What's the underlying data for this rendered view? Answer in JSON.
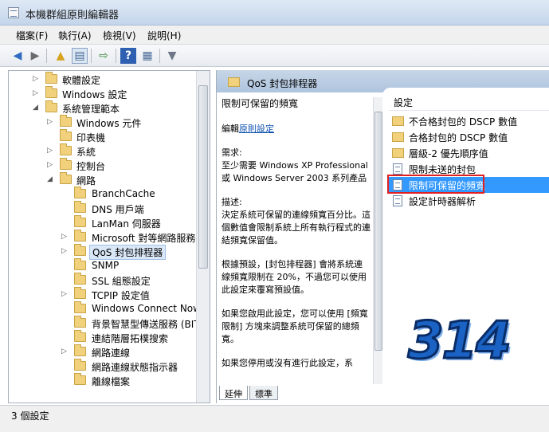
{
  "window": {
    "title": "本機群組原則編輯器"
  },
  "menubar": {
    "items": [
      "檔案(F)",
      "執行(A)",
      "檢視(V)",
      "說明(H)"
    ]
  },
  "toolbar": {
    "buttons": [
      "back-arrow",
      "forward-arrow",
      "up-folder",
      "show-hide-console-tree",
      "export-list",
      "help",
      "properties",
      "filter"
    ]
  },
  "tree": {
    "items": [
      {
        "label": "軟體設定",
        "expanded": false
      },
      {
        "label": "Windows 設定",
        "expanded": false
      },
      {
        "label": "系統管理範本",
        "expanded": true
      },
      {
        "label": "Windows 元件",
        "expanded": false
      },
      {
        "label": "印表機",
        "expanded": null
      },
      {
        "label": "系統",
        "expanded": false
      },
      {
        "label": "控制台",
        "expanded": false
      },
      {
        "label": "網路",
        "expanded": true
      },
      {
        "label": "BranchCache",
        "expanded": null
      },
      {
        "label": "DNS 用戶端",
        "expanded": null
      },
      {
        "label": "LanMan 伺服器",
        "expanded": null
      },
      {
        "label": "Microsoft 對等網路服務",
        "expanded": false
      },
      {
        "label": "QoS 封包排程器",
        "expanded": false,
        "selected": true
      },
      {
        "label": "SNMP",
        "expanded": null
      },
      {
        "label": "SSL 組態設定",
        "expanded": null
      },
      {
        "label": "TCPIP 設定值",
        "expanded": false
      },
      {
        "label": "Windows Connect Now",
        "expanded": null
      },
      {
        "label": "背景智慧型傳送服務 (BITS)",
        "expanded": null
      },
      {
        "label": "連結階層拓樸搜索",
        "expanded": null
      },
      {
        "label": "網路連線",
        "expanded": false
      },
      {
        "label": "網路連線狀態指示器",
        "expanded": null
      },
      {
        "label": "離線檔案",
        "expanded": null
      }
    ]
  },
  "details": {
    "header": "QoS 封包排程器",
    "setting_title": "限制可保留的頻寬",
    "edit_prefix": "編輯",
    "edit_link": "原則設定",
    "requirement_label": "需求:",
    "requirement_text": "至少需要 Windows XP Professional 或 Windows Server 2003 系列產品",
    "description_label": "描述:",
    "description_text": "決定系統可保留的連線頻寬百分比。這個數值會限制系統上所有執行程式的連結頻寬保留值。",
    "default_text": "根據預設，[封包排程器] 會將系統連線頻寬限制在 20%，不過您可以使用此設定來覆寫預設值。",
    "enable_text": "如果您啟用此設定，您可以使用 [頻寬限制] 方塊來調整系統可保留的總頻寬。",
    "cut_text": "如果您停用或沒有進行此設定，系"
  },
  "list": {
    "column_header": "設定",
    "items": [
      {
        "label": "不合格封包的 DSCP 數值",
        "icon": "folder-icon"
      },
      {
        "label": "合格封包的 DSCP 數值",
        "icon": "folder-icon"
      },
      {
        "label": "層級-2 優先順序值",
        "icon": "folder-icon"
      },
      {
        "label": "限制未送的封包",
        "icon": "setting-icon"
      },
      {
        "label": "限制可保留的頻寬",
        "icon": "setting-icon",
        "selected": true
      },
      {
        "label": "設定計時器解析",
        "icon": "setting-icon"
      }
    ]
  },
  "tabs": [
    "延伸",
    "標準"
  ],
  "watermark": "314",
  "statusbar": {
    "text": "3 個設定"
  },
  "colors": {
    "selection": "#3399ff",
    "highlight_box": "#e02020",
    "header": "#c7d6e7"
  }
}
